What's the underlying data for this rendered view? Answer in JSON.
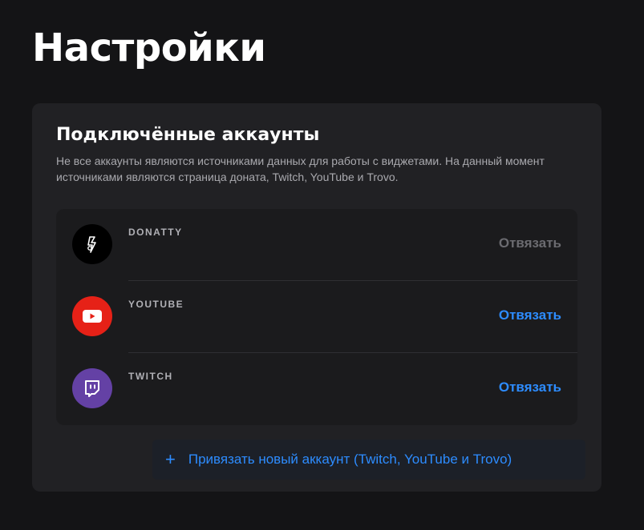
{
  "page": {
    "title": "Настройки"
  },
  "connected_accounts": {
    "title": "Подключённые аккаунты",
    "description": "Не все аккаунты являются источниками данных для работы с виджетами. На данный момент источниками являются страница доната, Twitch, YouTube и Trovo.",
    "items": [
      {
        "name": "DONATTY",
        "icon": "donatty-logo-icon",
        "action_label": "Отвязать",
        "action_enabled": false
      },
      {
        "name": "YOUTUBE",
        "icon": "youtube-logo-icon",
        "action_label": "Отвязать",
        "action_enabled": true
      },
      {
        "name": "TWITCH",
        "icon": "twitch-logo-icon",
        "action_label": "Отвязать",
        "action_enabled": true
      }
    ],
    "add_button": {
      "icon": "plus-icon",
      "label": "Привязать новый аккаунт (Twitch, YouTube и Trovo)"
    }
  },
  "colors": {
    "background": "#141416",
    "card": "#212124",
    "accent": "#2d8cff",
    "youtube": "#e62117",
    "twitch": "#6441a5",
    "disabled": "#6b6b70"
  }
}
